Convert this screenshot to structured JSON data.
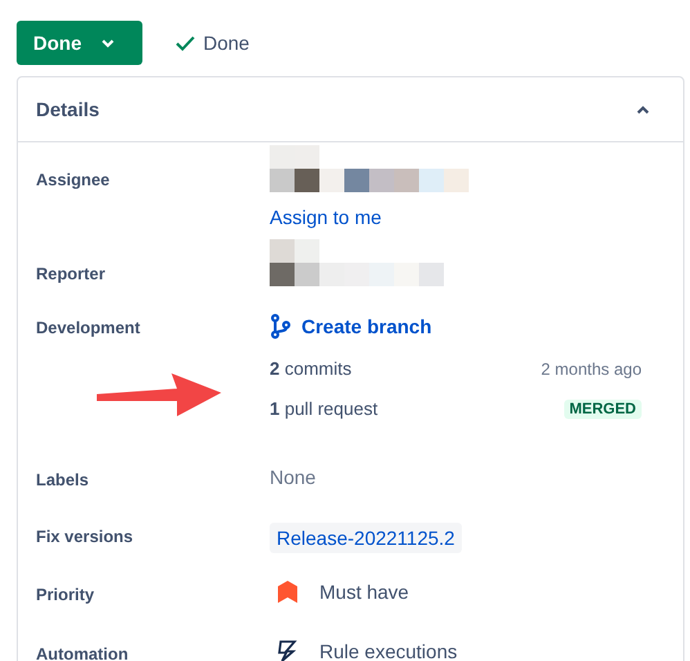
{
  "status_button": {
    "label": "Done"
  },
  "status_text": {
    "label": "Done"
  },
  "panel": {
    "title": "Details",
    "expanded": true
  },
  "fields": [
    {
      "label": "Assignee",
      "kind": "user",
      "action": "Assign to me"
    },
    {
      "label": "Reporter",
      "kind": "user"
    },
    {
      "label": "Development",
      "kind": "development",
      "action": "Create branch",
      "items": [
        {
          "text": "**2** commits",
          "meta": "2 months ago",
          "kind": "time"
        },
        {
          "text": "**1** pull request",
          "meta": "MERGED",
          "kind": "badge"
        }
      ]
    },
    {
      "label": "Labels",
      "kind": "text",
      "value": "None"
    },
    {
      "label": "Fix versions",
      "kind": "tag",
      "value": "Release-20221125.2"
    },
    {
      "label": "Priority",
      "kind": "priority",
      "value": "Must have"
    },
    {
      "label": "Automation",
      "kind": "automation",
      "value": "Rule executions"
    }
  ]
}
